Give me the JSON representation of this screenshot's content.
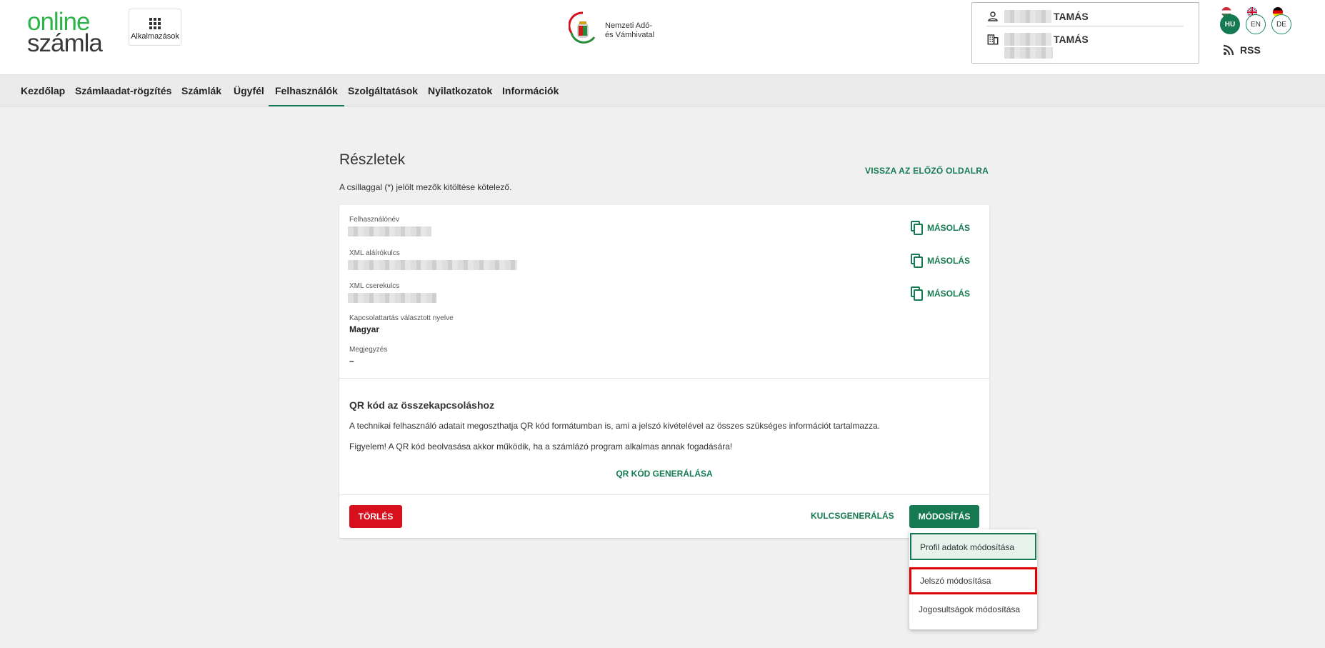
{
  "header": {
    "logo_line1": "online",
    "logo_line2": "számla",
    "apps_label": "Alkalmazások",
    "nav_line1": "Nemzeti Adó-",
    "nav_line2": "és Vámhivatal",
    "user": {
      "person_name": "TAMÁS",
      "company_name": "TAMÁS"
    },
    "languages": [
      {
        "code": "HU",
        "active": true
      },
      {
        "code": "EN",
        "active": false
      },
      {
        "code": "DE",
        "active": false
      }
    ],
    "rss_label": "RSS"
  },
  "nav": {
    "items": [
      {
        "label": "Kezdőlap"
      },
      {
        "label": "Számlaadat-rögzítés"
      },
      {
        "label": "Számlák"
      },
      {
        "label": "Ügyfél"
      },
      {
        "label": "Felhasználók",
        "active": true
      },
      {
        "label": "Szolgáltatások"
      },
      {
        "label": "Nyilatkozatok"
      },
      {
        "label": "Információk"
      }
    ]
  },
  "page": {
    "title": "Részletek",
    "back_link": "VISSZA AZ ELŐZŐ OLDALRA",
    "required_note": "A csillaggal (*) jelölt mezők kitöltése kötelező."
  },
  "details": {
    "username_label": "Felhasználónév",
    "signing_key_label": "XML aláírókulcs",
    "exchange_key_label": "XML cserekulcs",
    "language_label": "Kapcsolattartás választott nyelve",
    "language_value": "Magyar",
    "note_label": "Megjegyzés",
    "note_value": "–",
    "copy_label": "MÁSOLÁS"
  },
  "qr": {
    "title": "QR kód az összekapcsoláshoz",
    "text1": "A technikai felhasználó adatait megoszthatja QR kód formátumban is, ami a jelszó kivételével az összes szükséges információt tartalmazza.",
    "text2": "Figyelem! A QR kód beolvasása akkor működik, ha a számlázó program alkalmas annak fogadására!",
    "generate_label": "QR KÓD GENERÁLÁSA"
  },
  "actions": {
    "delete_label": "TÖRLÉS",
    "keygen_label": "KULCSGENERÁLÁS",
    "modify_label": "MÓDOSÍTÁS"
  },
  "modify_menu": {
    "items": [
      {
        "label": "Profil adatok módosítása"
      },
      {
        "label": "Jelszó módosítása"
      },
      {
        "label": "Jogosultságok módosítása"
      }
    ]
  },
  "colors": {
    "brand_green": "#157a52",
    "logo_green": "#2cb34a",
    "danger_red": "#d80f1c",
    "highlight_red": "#e00000"
  }
}
